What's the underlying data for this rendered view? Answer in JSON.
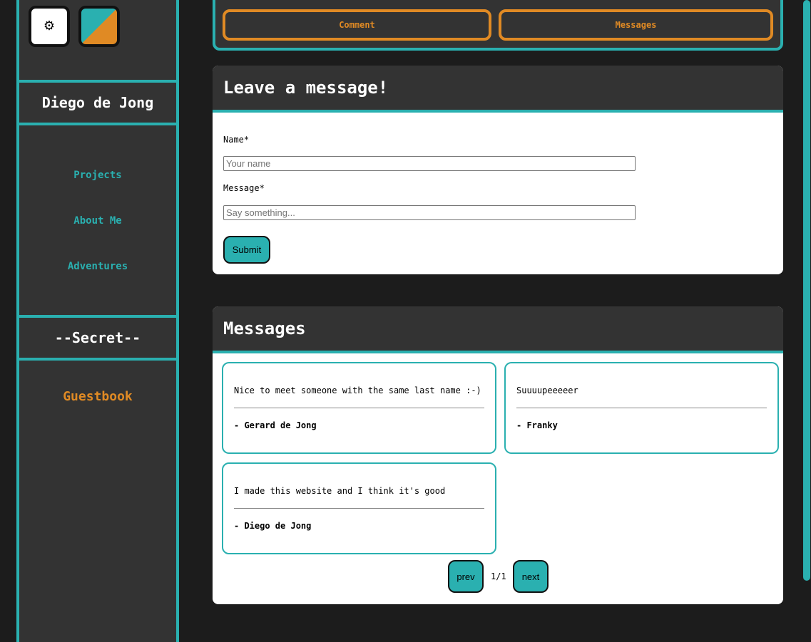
{
  "sidebar": {
    "name": "Diego de Jong",
    "nav": [
      "Projects",
      "About Me",
      "Adventures"
    ],
    "secret_title": "--Secret--",
    "guestbook": "Guestbook"
  },
  "topbar": {
    "comment": "Comment",
    "messages": "Messages"
  },
  "form": {
    "title": "Leave a message!",
    "name_label": "Name*",
    "name_placeholder": "Your name",
    "message_label": "Message*",
    "message_placeholder": "Say something...",
    "submit": "Submit"
  },
  "messages": {
    "title": "Messages",
    "items": [
      {
        "text": "Nice to meet someone with the same last name :-)",
        "author": "- Gerard de Jong"
      },
      {
        "text": "Suuuupeeeeer",
        "author": "- Franky"
      },
      {
        "text": "I made this website and I think it's good",
        "author": "- Diego de Jong"
      }
    ],
    "prev": "prev",
    "next": "next",
    "page_info": "1/1"
  },
  "colors": {
    "accent": "#2ab0b0",
    "highlight": "#e08a24",
    "panel": "#333333",
    "background": "#1c1c1c"
  }
}
